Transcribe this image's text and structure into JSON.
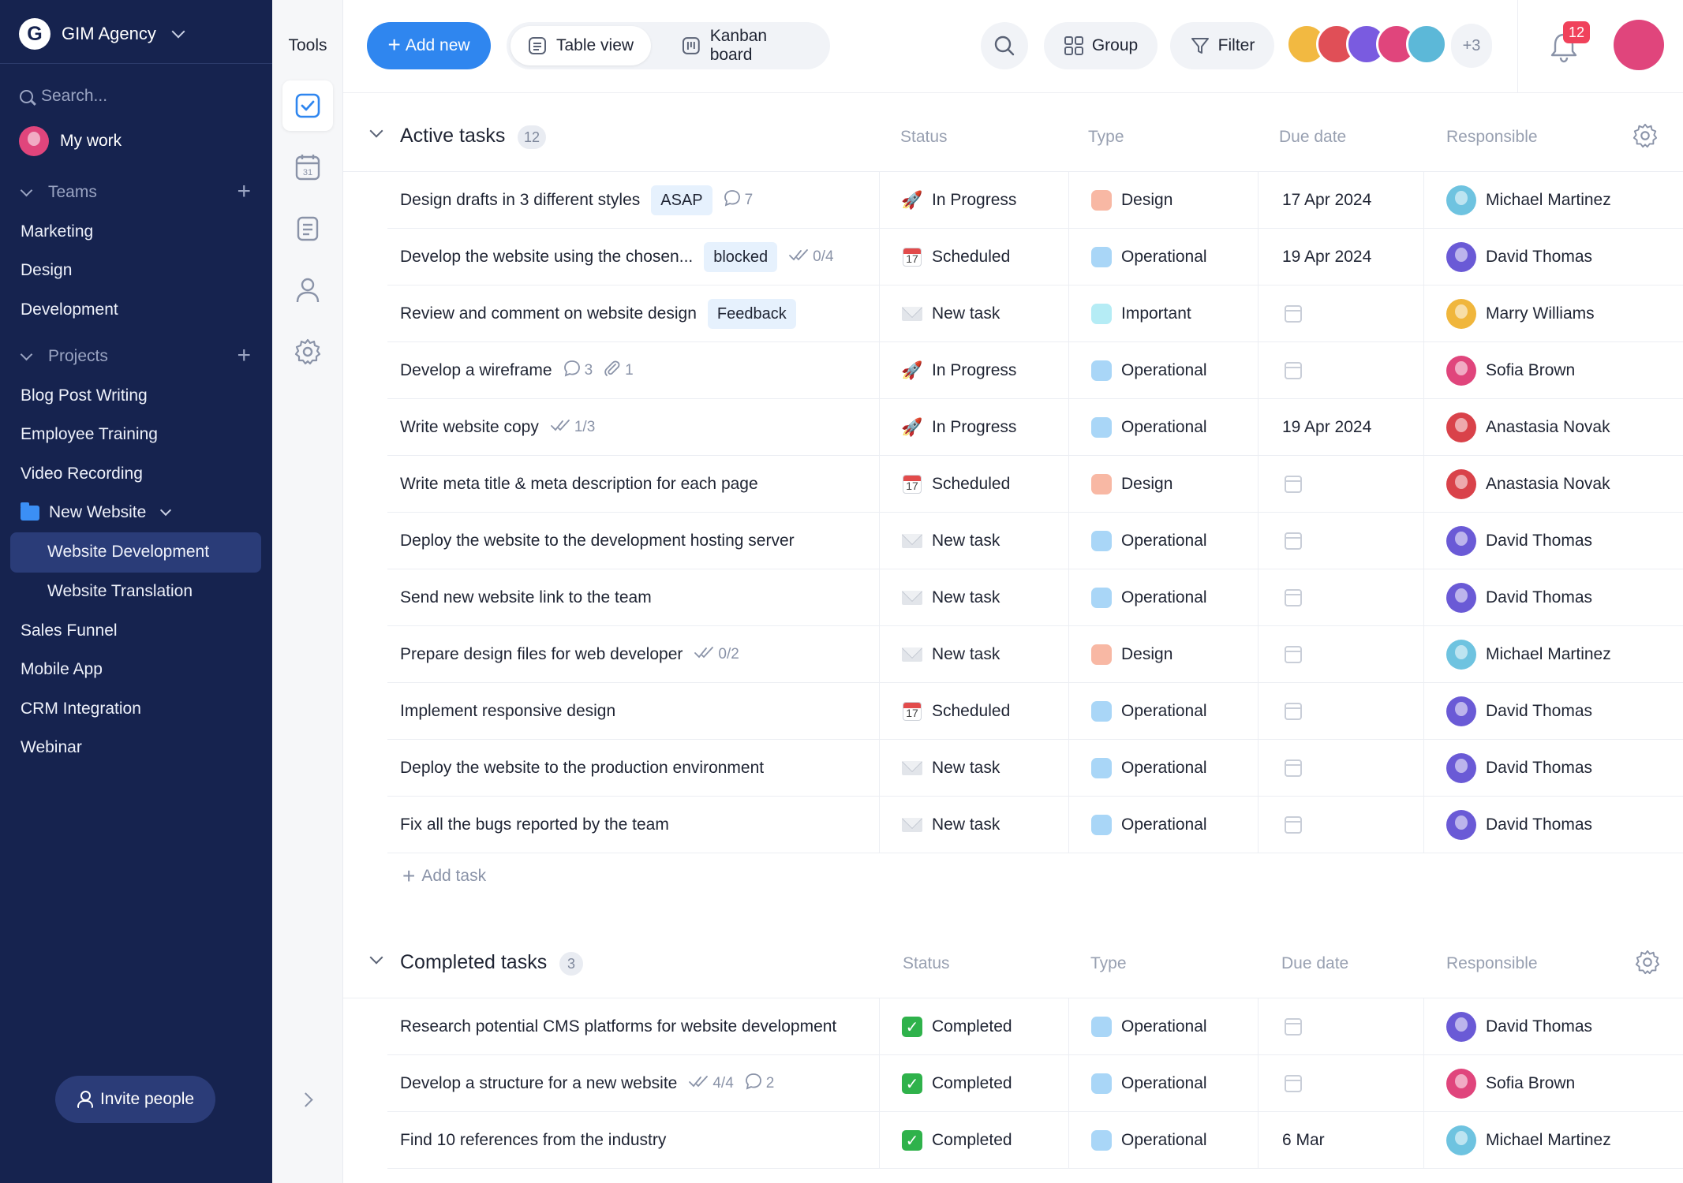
{
  "workspace": {
    "name": "GIM Agency",
    "logo_letter": "G"
  },
  "sidebar": {
    "search_placeholder": "Search...",
    "my_work": "My work",
    "teams_label": "Teams",
    "teams": [
      "Marketing",
      "Design",
      "Development"
    ],
    "projects_label": "Projects",
    "projects_top": [
      "Blog Post Writing",
      "Employee Training",
      "Video Recording"
    ],
    "folder": {
      "name": "New Website",
      "children": [
        "Website Development",
        "Website Translation"
      ],
      "active": "Website Development"
    },
    "projects_bottom": [
      "Sales Funnel",
      "Mobile App",
      "CRM Integration",
      "Webinar"
    ],
    "invite_label": "Invite people"
  },
  "tools": {
    "title": "Tools",
    "items": [
      "tasks-icon",
      "calendar-icon",
      "notes-icon",
      "people-icon",
      "settings-icon"
    ],
    "calendar_day": "31"
  },
  "toolbar": {
    "add_new": "Add new",
    "table_view": "Table view",
    "kanban_board": "Kanban board",
    "group": "Group",
    "filter": "Filter",
    "members_more": "+3",
    "notifications": "12",
    "member_colors": [
      "#f2b941",
      "#e04f57",
      "#7a5be0",
      "#e0457c",
      "#5cb8d8"
    ]
  },
  "columns": {
    "status": "Status",
    "type": "Type",
    "due": "Due date",
    "responsible": "Responsible"
  },
  "type_colors": {
    "Design": "#f8b8a4",
    "Operational": "#a9d6f7",
    "Important": "#b5ecf5"
  },
  "people_colors": {
    "Michael Martinez": "#6ec3e0",
    "David Thomas": "#6a5ad6",
    "Marry Williams": "#f0b63c",
    "Sofia Brown": "#e0457c",
    "Anastasia Novak": "#d9424a"
  },
  "active": {
    "title": "Active tasks",
    "count": "12",
    "tasks": [
      {
        "name": "Design drafts in 3 different styles",
        "tag": "ASAP",
        "meta": [
          {
            "icon": "comment-icon",
            "text": "7"
          }
        ],
        "status": "In Progress",
        "status_icon": "rocket",
        "type": "Design",
        "due": "17 Apr 2024",
        "responsible": "Michael Martinez"
      },
      {
        "name": "Develop the website using the chosen...",
        "tag": "blocked",
        "meta": [
          {
            "icon": "checklist-icon",
            "text": "0/4"
          }
        ],
        "status": "Scheduled",
        "status_icon": "calendar",
        "type": "Operational",
        "due": "19 Apr 2024",
        "responsible": "David Thomas"
      },
      {
        "name": "Review and comment on website design",
        "tag": "Feedback",
        "meta": [],
        "status": "New task",
        "status_icon": "envelope",
        "type": "Important",
        "due": "",
        "responsible": "Marry Williams"
      },
      {
        "name": "Develop a wireframe",
        "tag": "",
        "meta": [
          {
            "icon": "comment-icon",
            "text": "3"
          },
          {
            "icon": "attachment-icon",
            "text": "1"
          }
        ],
        "status": "In Progress",
        "status_icon": "rocket",
        "type": "Operational",
        "due": "",
        "responsible": "Sofia Brown"
      },
      {
        "name": "Write website copy",
        "tag": "",
        "meta": [
          {
            "icon": "checklist-icon",
            "text": "1/3"
          }
        ],
        "status": "In Progress",
        "status_icon": "rocket",
        "type": "Operational",
        "due": "19 Apr 2024",
        "responsible": "Anastasia Novak"
      },
      {
        "name": "Write meta title & meta description for each page",
        "tag": "",
        "meta": [],
        "status": "Scheduled",
        "status_icon": "calendar",
        "type": "Design",
        "due": "",
        "responsible": "Anastasia Novak"
      },
      {
        "name": "Deploy the website to the development hosting server",
        "tag": "",
        "meta": [],
        "status": "New task",
        "status_icon": "envelope",
        "type": "Operational",
        "due": "",
        "responsible": "David Thomas"
      },
      {
        "name": "Send new website link to the team",
        "tag": "",
        "meta": [],
        "status": "New task",
        "status_icon": "envelope",
        "type": "Operational",
        "due": "",
        "responsible": "David Thomas"
      },
      {
        "name": "Prepare design files for web developer",
        "tag": "",
        "meta": [
          {
            "icon": "checklist-icon",
            "text": "0/2"
          }
        ],
        "status": "New task",
        "status_icon": "envelope",
        "type": "Design",
        "due": "",
        "responsible": "Michael Martinez"
      },
      {
        "name": "Implement responsive design",
        "tag": "",
        "meta": [],
        "status": "Scheduled",
        "status_icon": "calendar",
        "type": "Operational",
        "due": "",
        "responsible": "David Thomas"
      },
      {
        "name": "Deploy the website to the production environment",
        "tag": "",
        "meta": [],
        "status": "New task",
        "status_icon": "envelope",
        "type": "Operational",
        "due": "",
        "responsible": "David Thomas"
      },
      {
        "name": "Fix all the bugs reported by the team",
        "tag": "",
        "meta": [],
        "status": "New task",
        "status_icon": "envelope",
        "type": "Operational",
        "due": "",
        "responsible": "David Thomas"
      }
    ],
    "add_task": "Add task"
  },
  "completed": {
    "title": "Completed tasks",
    "count": "3",
    "tasks": [
      {
        "name": "Research potential CMS platforms for website development",
        "tag": "",
        "meta": [],
        "status": "Completed",
        "status_icon": "check",
        "type": "Operational",
        "due": "",
        "responsible": "David Thomas"
      },
      {
        "name": "Develop a structure for a new website",
        "tag": "",
        "meta": [
          {
            "icon": "checklist-icon",
            "text": "4/4"
          },
          {
            "icon": "comment-icon",
            "text": "2"
          }
        ],
        "status": "Completed",
        "status_icon": "check",
        "type": "Operational",
        "due": "",
        "responsible": "Sofia Brown"
      },
      {
        "name": "Find 10 references from the industry",
        "tag": "",
        "meta": [],
        "status": "Completed",
        "status_icon": "check",
        "type": "Operational",
        "due": "6 Mar",
        "responsible": "Michael Martinez"
      }
    ]
  }
}
